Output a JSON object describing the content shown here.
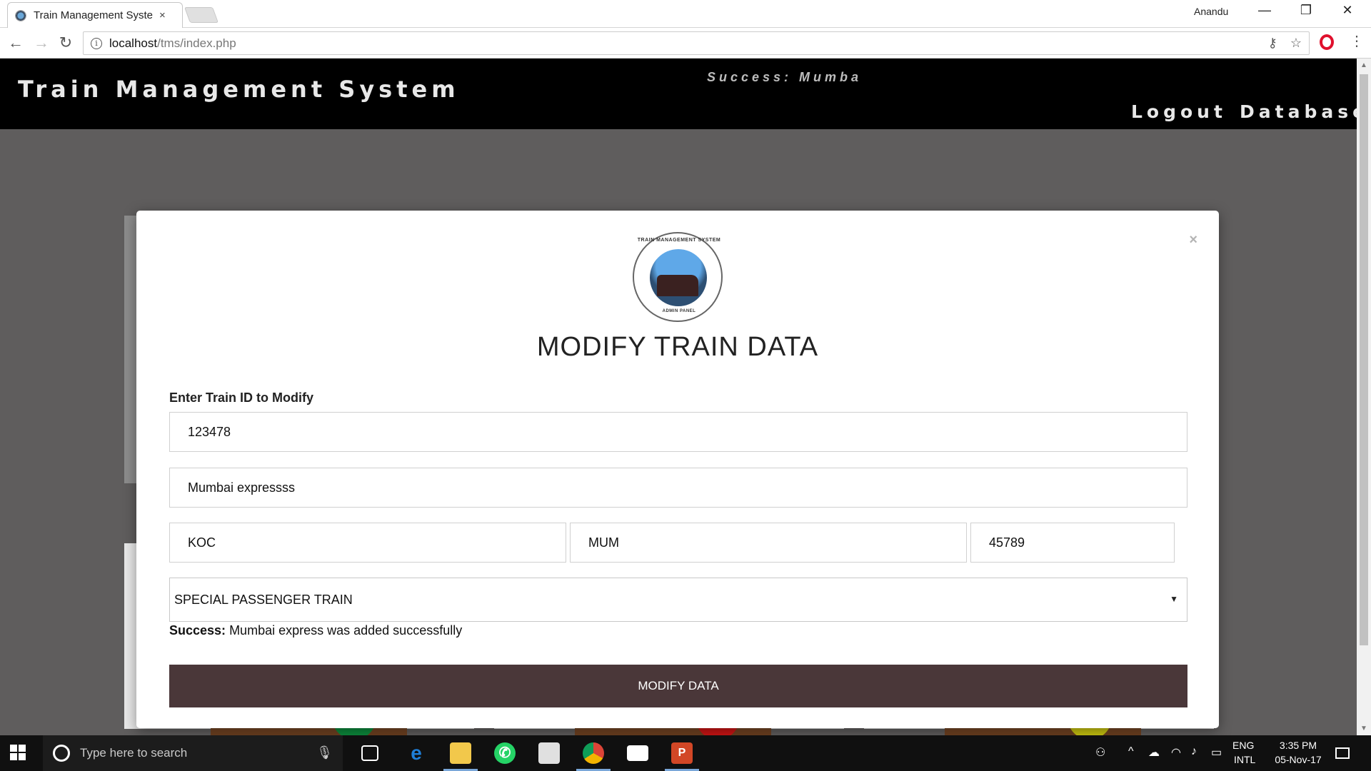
{
  "browser": {
    "tab_title": "Train Management Syste",
    "tab_close": "×",
    "user": "Anandu",
    "window_controls": [
      "—",
      "❐",
      "✕"
    ],
    "url_host": "localhost",
    "url_path": "/tms/index.php"
  },
  "site": {
    "title": "Train Management System",
    "header_status": "Success: Mumba",
    "nav": [
      {
        "label": "Logout"
      },
      {
        "label": "Database"
      }
    ]
  },
  "modal": {
    "close": "×",
    "logo_text_top": "TRAIN MANAGEMENT SYSTEM",
    "logo_text_bottom": "ADMIN PANEL",
    "heading": "MODIFY TRAIN DATA",
    "label": "Enter Train ID to Modify",
    "train_id": "123478",
    "train_name": "Mumbai expressss",
    "source": "KOC",
    "destination": "MUM",
    "number": "45789",
    "train_type": "SPECIAL PASSENGER TRAIN",
    "message_bold": "Success:",
    "message_text": " Mumbai express was added successfully",
    "submit": "MODIFY DATA"
  },
  "background_actions": [
    {
      "icon": "+",
      "color": "#0c8a3c"
    },
    {
      "icon": "−",
      "color": "#cc1414"
    },
    {
      "icon": "✎",
      "color": "#c8c410"
    }
  ],
  "taskbar": {
    "search_placeholder": "Type here to search",
    "lang_top": "ENG",
    "lang_bottom": "INTL",
    "time": "3:35 PM",
    "date": "05-Nov-17"
  }
}
